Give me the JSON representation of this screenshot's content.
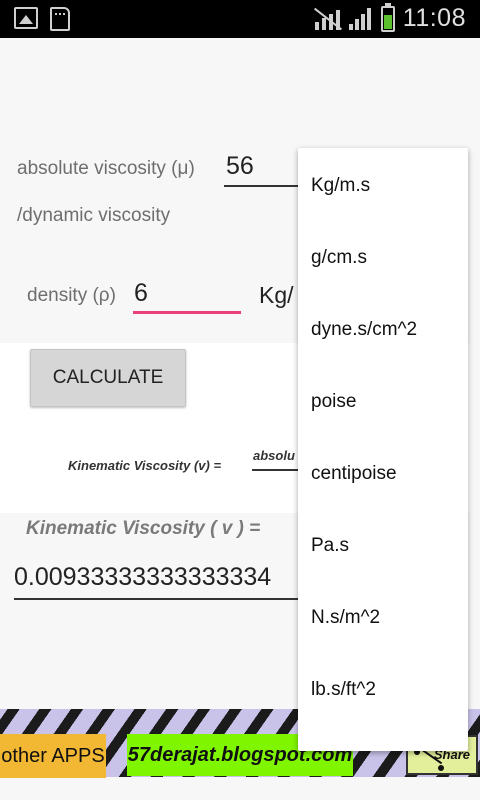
{
  "status_bar": {
    "time": "11:08",
    "icons": [
      "image-icon",
      "sd-card-icon",
      "mute-icon",
      "signal-icon",
      "battery-icon"
    ]
  },
  "form": {
    "viscosity_label_line1": "absolute viscosity (μ)",
    "viscosity_label_line2": "/dynamic viscosity",
    "viscosity_value": "56",
    "density_label": "density (ρ)",
    "density_value": "6",
    "density_unit_partial": "Kg/"
  },
  "calculate_button": {
    "label": "CALCULATE"
  },
  "formula": {
    "lhs": "Kinematic Viscosity (v) =",
    "numerator_partial": "absolu"
  },
  "result": {
    "label": "Kinematic Viscosity ( v ) =",
    "value": "0.00933333333333334"
  },
  "footer": {
    "other_apps": "other APPS",
    "blog_link": "57derajat.blogspot.com",
    "share": "Share"
  },
  "viscosity_unit_dropdown": {
    "options": [
      "Kg/m.s",
      "g/cm.s",
      "dyne.s/cm^2",
      "poise",
      "centipoise",
      "Pa.s",
      "N.s/m^2",
      "lb.s/ft^2"
    ]
  },
  "colors": {
    "accent_pink": "#e8407a",
    "status_bar": "#000000",
    "battery_green": "#5bbf2e",
    "other_apps_bg": "#f2b733",
    "blog_link_bg": "#7ff500",
    "share_bg": "#e4ef9c"
  }
}
